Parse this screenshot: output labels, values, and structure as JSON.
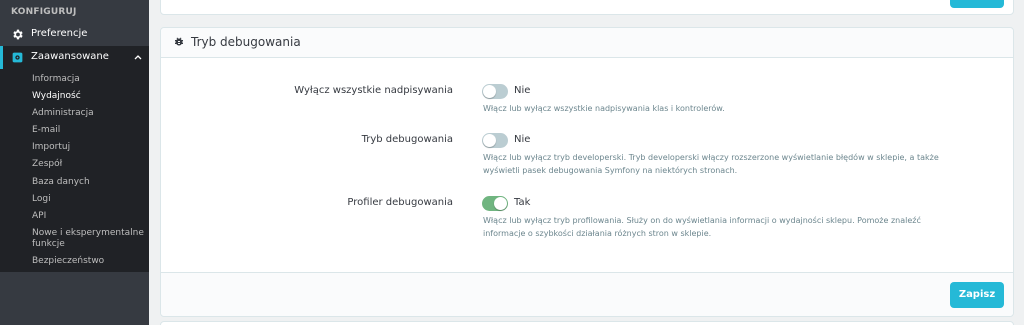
{
  "colors": {
    "accent": "#25b9d7",
    "sidebar_bg": "#363a41",
    "toggle_on": "#70b580",
    "toggle_off": "#bbcdd2"
  },
  "sidebar": {
    "section_title": "KONFIGURUJ",
    "items": [
      {
        "label": "Preferencje",
        "icon": "gear-icon"
      },
      {
        "label": "Zaawansowane",
        "icon": "settings-square-icon",
        "expanded": true
      }
    ],
    "submenu": [
      "Informacja",
      "Wydajność",
      "Administracja",
      "E-mail",
      "Importuj",
      "Zespół",
      "Baza danych",
      "Logi",
      "API",
      "Nowe i eksperymentalne",
      "funkcje",
      "Bezpieczeństwo"
    ],
    "active_submenu": "Wydajność"
  },
  "panel": {
    "icon": "bug-icon",
    "title": "Tryb debugowania",
    "rows": [
      {
        "label": "Wyłącz wszystkie nadpisywania",
        "toggle_state": false,
        "toggle_text": "Nie",
        "help": [
          "Włącz lub wyłącz wszystkie nadpisywania klas i kontrolerów."
        ]
      },
      {
        "label": "Tryb debugowania",
        "toggle_state": false,
        "toggle_text": "Nie",
        "help": [
          "Włącz lub wyłącz tryb developerski. Tryb developerski włączy rozszerzone wyświetlanie błędów w sklepie, a także",
          "wyświetli pasek debugowania Symfony na niektórych stronach."
        ]
      },
      {
        "label": "Profiler debugowania",
        "toggle_state": true,
        "toggle_text": "Tak",
        "help": [
          "Włącz lub wyłącz tryb profilowania. Służy on do wyświetlania informacji o wydajności sklepu. Pomoże znaleźć",
          "informacje o szybkości działania różnych stron w sklepie."
        ]
      }
    ],
    "save_label": "Zapisz"
  }
}
